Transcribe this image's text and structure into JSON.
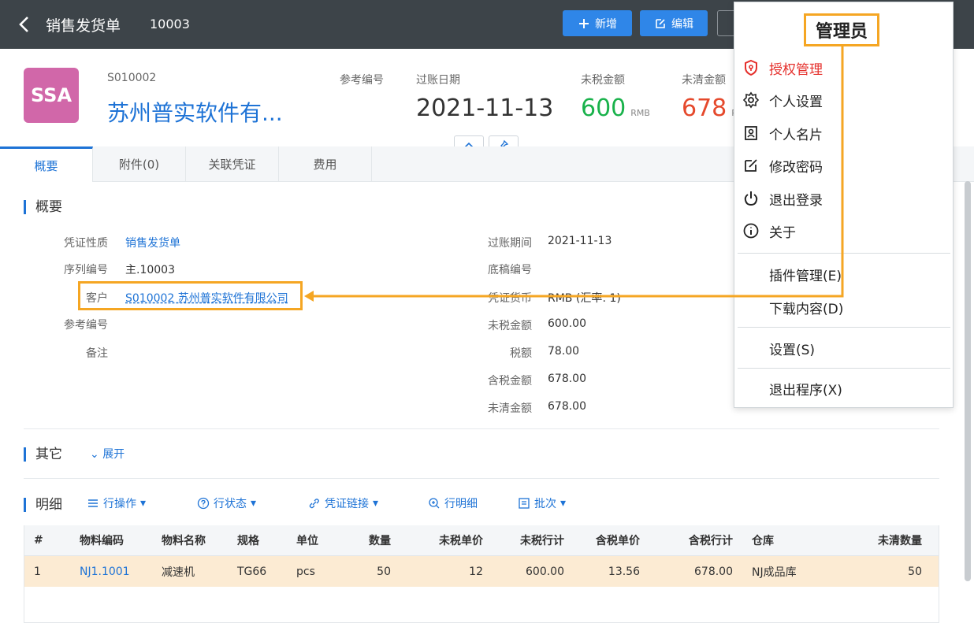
{
  "topbar": {
    "title": "销售发货单",
    "doc_number": "10003",
    "new_label": "新增",
    "edit_label": "编辑"
  },
  "header": {
    "avatar_text": "SSA",
    "customer_code": "S010002",
    "customer_name": "苏州普实软件有...",
    "ref_label": "参考编号",
    "post_date_label": "过账日期",
    "post_date": "2021-11-13",
    "untaxed_label": "未税金额",
    "untaxed_value": "600",
    "untaxed_unit": "RMB",
    "open_label": "未清金额",
    "open_value": "678",
    "open_unit": "R"
  },
  "tabs": [
    "概要",
    "附件(0)",
    "关联凭证",
    "费用"
  ],
  "overview": {
    "title": "概要",
    "left": [
      {
        "label": "凭证性质",
        "value": "销售发货单"
      },
      {
        "label": "序列编号",
        "value": "主.10003"
      },
      {
        "label": "客户",
        "value": "S010002 苏州普实软件有限公司"
      },
      {
        "label": "参考编号",
        "value": ""
      },
      {
        "label": "备注",
        "value": ""
      }
    ],
    "right": [
      {
        "label": "过账期间",
        "value": "2021-11-13"
      },
      {
        "label": "底稿编号",
        "value": ""
      },
      {
        "label": "凭证货币",
        "value": "RMB (汇率: 1)"
      },
      {
        "label": "未税金额",
        "value": "600.00"
      },
      {
        "label": "税额",
        "value": "78.00"
      },
      {
        "label": "含税金额",
        "value": "678.00"
      },
      {
        "label": "未清金额",
        "value": "678.00"
      }
    ]
  },
  "other": {
    "title": "其它",
    "expand": "展开"
  },
  "detail": {
    "title": "明细",
    "tools": [
      "行操作",
      "行状态",
      "凭证链接",
      "行明细",
      "批次"
    ],
    "columns": [
      "#",
      "物料编码",
      "物料名称",
      "规格",
      "单位",
      "数量",
      "未税单价",
      "未税行计",
      "含税单价",
      "含税行计",
      "仓库",
      "未清数量"
    ],
    "rows": [
      [
        "1",
        "NJ1.1001",
        "减速机",
        "TG66",
        "pcs",
        "50",
        "12",
        "600.00",
        "13.56",
        "678.00",
        "NJ成品库",
        "50"
      ]
    ]
  },
  "user_menu": {
    "admin_label": "管理员",
    "items": [
      "授权管理",
      "个人设置",
      "个人名片",
      "修改密码",
      "退出登录",
      "关于"
    ],
    "items2": [
      "插件管理(E)",
      "下载内容(D)"
    ],
    "items3": [
      "设置(S)"
    ],
    "items4": [
      "退出程序(X)"
    ]
  },
  "colors": {
    "accent": "#2f86e8",
    "highlight": "#f5a623",
    "topbar": "#3d4449",
    "row_selected": "#fcebd3"
  }
}
